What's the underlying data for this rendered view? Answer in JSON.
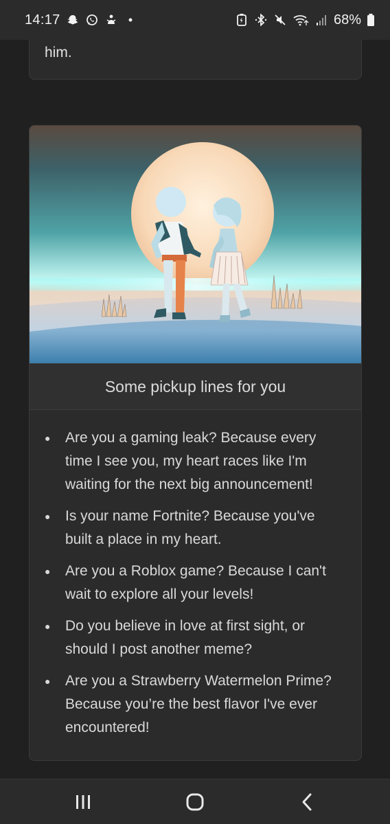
{
  "status_bar": {
    "time": "14:17",
    "battery_percent": "68%",
    "left_icons": [
      "snapchat-icon",
      "whatsapp-icon",
      "notification-icon",
      "dot-icon"
    ],
    "right_icons": [
      "battery-saver-icon",
      "bluetooth-icon",
      "mute-icon",
      "wifi-icon",
      "signal-icon",
      "battery-icon"
    ]
  },
  "previous_card": {
    "text_tail": "him."
  },
  "card": {
    "title": "Some pickup lines for you",
    "image_icon": "couple-illustration",
    "lines": [
      "Are you a gaming leak? Because every time I see you, my heart races like I'm waiting for the next big announcement!",
      "Is your name Fortnite? Because you've built a place in my heart.",
      "Are you a Roblox game? Because I can't wait to explore all your levels!",
      "Do you believe in love at first sight, or should I post another meme?",
      "Are you a Strawberry Watermelon Prime? Because you’re the best flavor I've ever encountered!"
    ]
  },
  "nav_bar": {
    "buttons": [
      "recent-apps-icon",
      "home-icon",
      "back-icon"
    ]
  },
  "colors": {
    "background": "#202020",
    "card": "#2b2b2b",
    "text": "#d9d9d9"
  }
}
